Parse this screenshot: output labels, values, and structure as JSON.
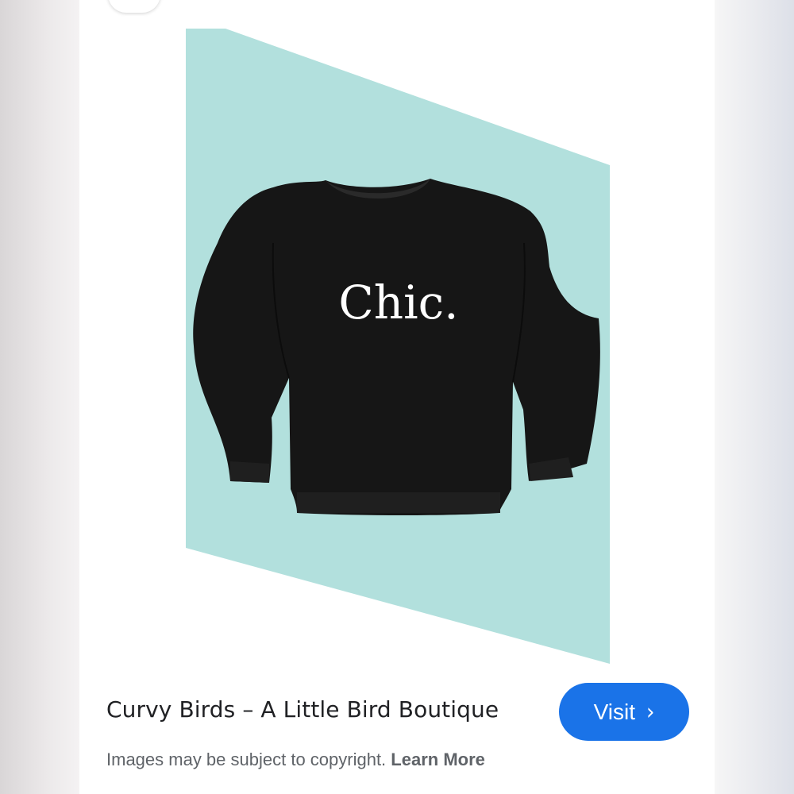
{
  "product_image": {
    "shirt_text": "Chic.",
    "background_color": "#b2e0dd",
    "garment_color": "#161616"
  },
  "result": {
    "source_title": "Curvy Birds – A Little Bird Boutique",
    "visit_label": "Visit",
    "visit_icon": "chevron-right-icon",
    "accent_color": "#1a73e8"
  },
  "footer": {
    "copyright_text": "Images may be subject to copyright.",
    "learn_more_label": "Learn More"
  },
  "top_control_icon": "search-icon"
}
